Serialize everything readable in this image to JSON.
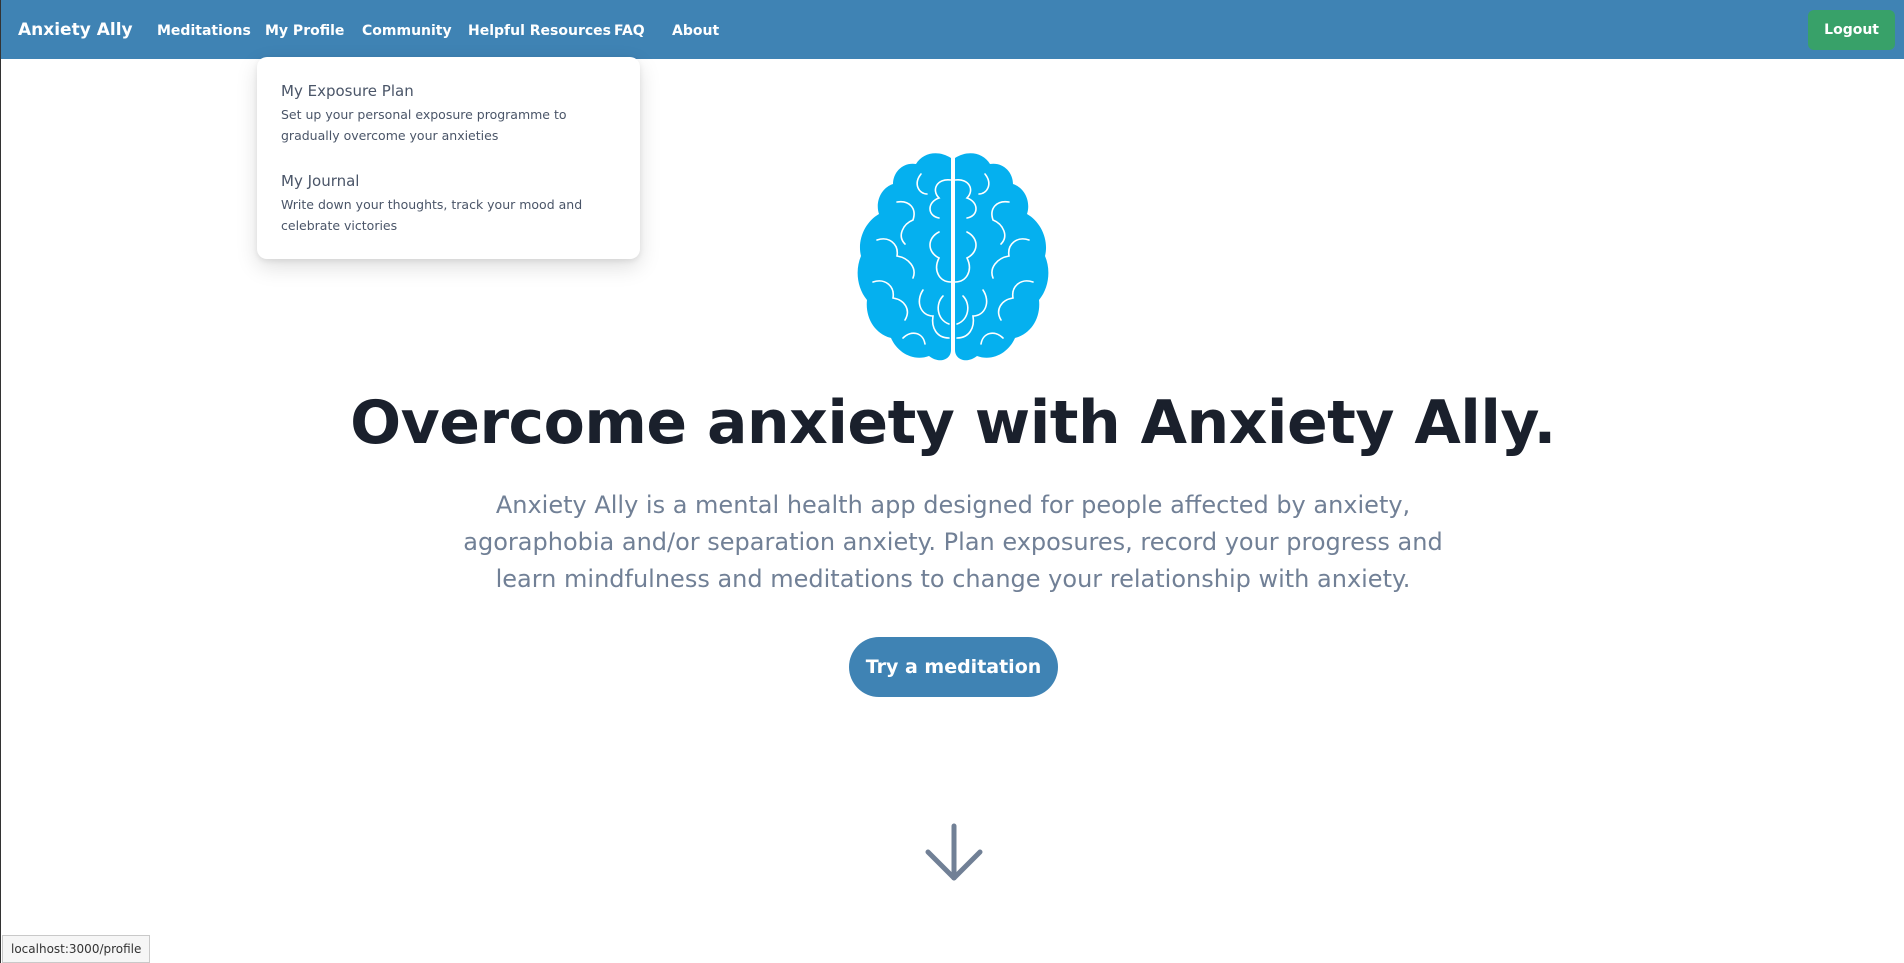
{
  "nav": {
    "brand": "Anxiety Ally",
    "items": [
      {
        "label": "Meditations"
      },
      {
        "label": "My Profile"
      },
      {
        "label": "Community"
      },
      {
        "label": "Helpful Resources"
      },
      {
        "label": "FAQ"
      },
      {
        "label": "About"
      }
    ],
    "logout_label": "Logout"
  },
  "profile_menu": {
    "items": [
      {
        "title": "My Exposure Plan",
        "description": "Set up your personal exposure programme to gradually overcome your anxieties"
      },
      {
        "title": "My Journal",
        "description": "Write down your thoughts, track your mood and celebrate victories"
      }
    ]
  },
  "hero": {
    "icon": "brain-icon",
    "headline": "Overcome anxiety with Anxiety Ally.",
    "description": "Anxiety Ally is a mental health app designed for people affected by anxiety, agoraphobia and/or separation anxiety. Plan exposures, record your progress and learn mindfulness and meditations to change your relationship with anxiety.",
    "cta_label": "Try a meditation",
    "scroll_icon": "arrow-down-icon"
  },
  "status_bar": {
    "url": "localhost:3000/profile"
  },
  "colors": {
    "nav_bg": "#3f83b4",
    "logout_bg": "#38a169",
    "brain": "#05b0ef",
    "heading": "#1a202c",
    "muted": "#718096"
  }
}
